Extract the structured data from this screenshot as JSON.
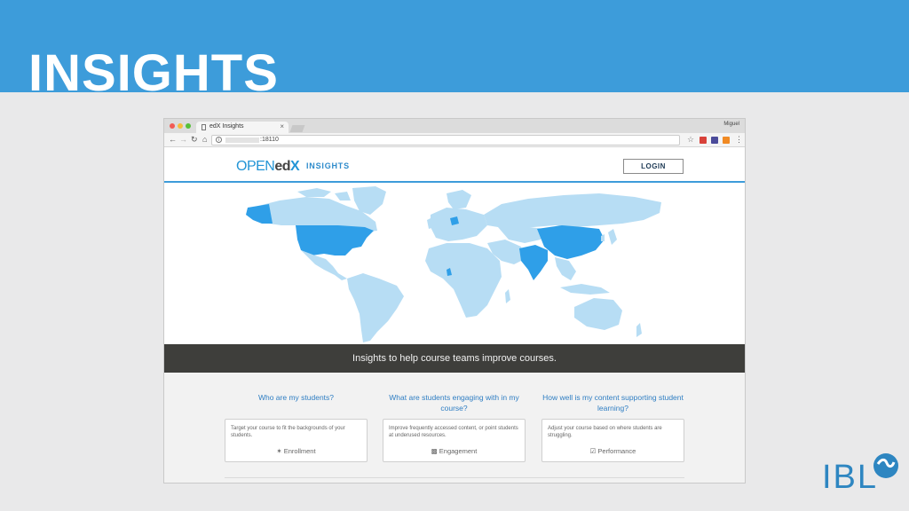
{
  "slide": {
    "title": "INSIGHTS",
    "brand": "IBL"
  },
  "browser": {
    "tab_title": "edX Insights",
    "tab_close": "×",
    "profile": "Miguel",
    "url_visible": ":18110"
  },
  "site": {
    "logo_open": "OPEN",
    "logo_edx": "ed",
    "logo_x": "X",
    "logo_insights": "INSIGHTS",
    "login_label": "LOGIN",
    "banner": "Insights to help course teams improve courses."
  },
  "questions": [
    {
      "heading": "Who are my students?",
      "description": "Target your course to fit the backgrounds of your students.",
      "link": "Enrollment",
      "icon": "person-icon"
    },
    {
      "heading": "What are students engaging with in my course?",
      "description": "Improve frequently accessed content, or point students at underused resources.",
      "link": "Engagement",
      "icon": "bar-chart-icon"
    },
    {
      "heading": "How well is my content supporting student learning?",
      "description": "Adjust your course based on where students are struggling.",
      "link": "Performance",
      "icon": "check-square-icon"
    }
  ],
  "colors": {
    "slide_band": "#3d9cda",
    "map_light": "#b7ddf4",
    "map_highlight": "#2f9fe8",
    "banner": "#3e3e3b",
    "link_blue": "#2f7ec3"
  }
}
